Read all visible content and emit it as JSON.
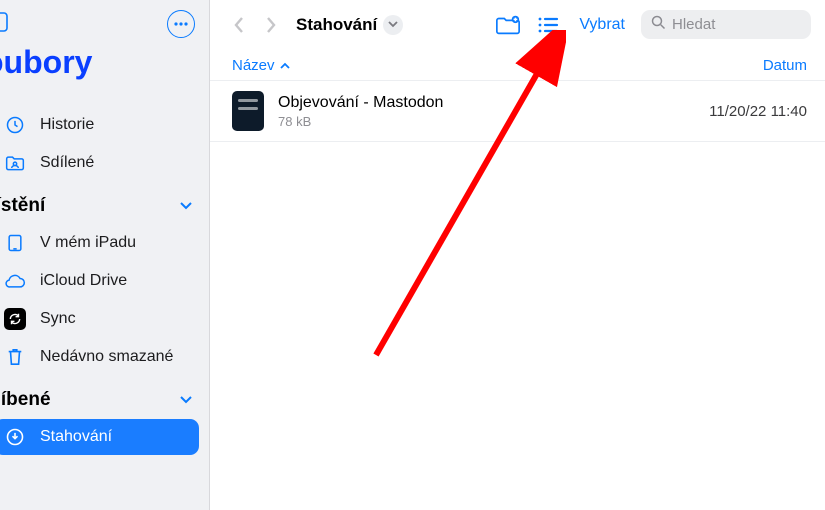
{
  "sidebar": {
    "title": "oubory",
    "sections": [
      {
        "title": null,
        "items": [
          {
            "label": "Historie",
            "icon": "clock"
          },
          {
            "label": "Sdílené",
            "icon": "folder-shared"
          }
        ]
      },
      {
        "title": "nístění",
        "items": [
          {
            "label": "V mém iPadu",
            "icon": "ipad"
          },
          {
            "label": "iCloud Drive",
            "icon": "icloud"
          },
          {
            "label": "Sync",
            "icon": "sync-app"
          },
          {
            "label": "Nedávno smazané",
            "icon": "trash"
          }
        ]
      },
      {
        "title": "dlíbené",
        "items": [
          {
            "label": "Stahování",
            "icon": "download-folder",
            "active": true
          }
        ]
      }
    ]
  },
  "toolbar": {
    "folder_name": "Stahování",
    "select_label": "Vybrat",
    "search_placeholder": "Hledat"
  },
  "columns": {
    "name": "Název",
    "date": "Datum"
  },
  "files": [
    {
      "name": "Objevování - Mastodon",
      "size": "78 kB",
      "date": "11/20/22 11:40"
    }
  ]
}
